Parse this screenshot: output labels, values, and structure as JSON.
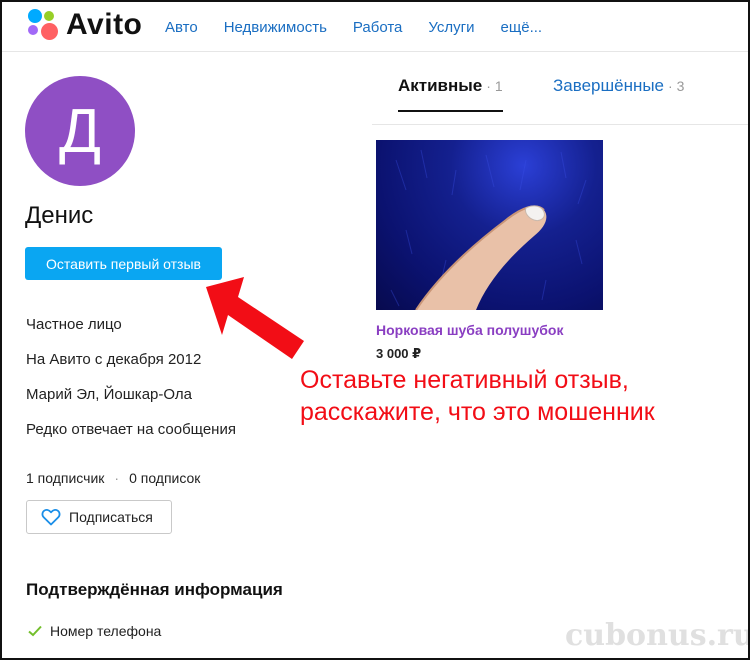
{
  "brand": {
    "name": "Avito",
    "dot_colors": [
      "#00aaff",
      "#97cf26",
      "#ff6163",
      "#a169f7"
    ]
  },
  "nav": {
    "items": [
      "Авто",
      "Недвижимость",
      "Работа",
      "Услуги",
      "ещё..."
    ]
  },
  "profile": {
    "avatar_letter": "Д",
    "avatar_color": "#8f4fc4",
    "name": "Денис",
    "review_button": "Оставить первый отзыв",
    "info": [
      "Частное лицо",
      "На Авито с декабря 2012",
      "Марий Эл, Йошкар-Ола",
      "Редко отвечает на сообщения"
    ],
    "followers": "1 подписчик",
    "followers_sep": "·",
    "following": "0 подписок",
    "subscribe_button": "Подписаться",
    "verified_title": "Подтверждённая информация",
    "verified_items": [
      "Номер телефона"
    ]
  },
  "tabs": {
    "active": {
      "label": "Активные",
      "count": "· 1"
    },
    "inactive": {
      "label": "Завершённые",
      "count": "· 3"
    }
  },
  "listing": {
    "title": "Норковая шуба полушубок",
    "price": "3 000 ₽"
  },
  "annotation": {
    "line1": "Оставьте негативный отзыв,",
    "line2": "расскажите, что это мошенник",
    "color": "#f20d16"
  },
  "watermark": "cubonus.ru"
}
